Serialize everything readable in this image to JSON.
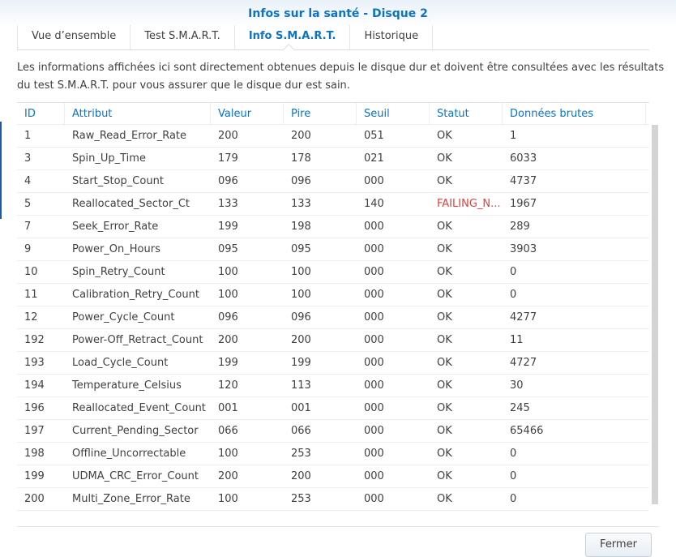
{
  "title": "Infos sur la santé - Disque 2",
  "tabs": [
    {
      "label": "Vue d’ensemble"
    },
    {
      "label": "Test S.M.A.R.T."
    },
    {
      "label": "Info S.M.A.R.T."
    },
    {
      "label": "Historique"
    }
  ],
  "active_tab": 2,
  "description": "Les informations affichées ici sont directement obtenues depuis le disque dur et doivent être consultées avec les résultats du test S.M.A.R.T. pour vous assurer que le disque dur est sain.",
  "columns": [
    "ID",
    "Attribut",
    "Valeur",
    "Pire",
    "Seuil",
    "Statut",
    "Données brutes"
  ],
  "rows": [
    [
      "1",
      "Raw_Read_Error_Rate",
      "200",
      "200",
      "051",
      "OK",
      "1"
    ],
    [
      "3",
      "Spin_Up_Time",
      "179",
      "178",
      "021",
      "OK",
      "6033"
    ],
    [
      "4",
      "Start_Stop_Count",
      "096",
      "096",
      "000",
      "OK",
      "4737"
    ],
    [
      "5",
      "Reallocated_Sector_Ct",
      "133",
      "133",
      "140",
      "FAILING_N...",
      "1967"
    ],
    [
      "7",
      "Seek_Error_Rate",
      "199",
      "198",
      "000",
      "OK",
      "289"
    ],
    [
      "9",
      "Power_On_Hours",
      "095",
      "095",
      "000",
      "OK",
      "3903"
    ],
    [
      "10",
      "Spin_Retry_Count",
      "100",
      "100",
      "000",
      "OK",
      "0"
    ],
    [
      "11",
      "Calibration_Retry_Count",
      "100",
      "100",
      "000",
      "OK",
      "0"
    ],
    [
      "12",
      "Power_Cycle_Count",
      "096",
      "096",
      "000",
      "OK",
      "4277"
    ],
    [
      "192",
      "Power-Off_Retract_Count",
      "200",
      "200",
      "000",
      "OK",
      "11"
    ],
    [
      "193",
      "Load_Cycle_Count",
      "199",
      "199",
      "000",
      "OK",
      "4727"
    ],
    [
      "194",
      "Temperature_Celsius",
      "120",
      "113",
      "000",
      "OK",
      "30"
    ],
    [
      "196",
      "Reallocated_Event_Count",
      "001",
      "001",
      "000",
      "OK",
      "245"
    ],
    [
      "197",
      "Current_Pending_Sector",
      "066",
      "066",
      "000",
      "OK",
      "65466"
    ],
    [
      "198",
      "Offline_Uncorrectable",
      "100",
      "253",
      "000",
      "OK",
      "0"
    ],
    [
      "199",
      "UDMA_CRC_Error_Count",
      "200",
      "200",
      "000",
      "OK",
      "0"
    ],
    [
      "200",
      "Multi_Zone_Error_Rate",
      "100",
      "253",
      "000",
      "OK",
      "0"
    ]
  ],
  "close_label": "Fermer",
  "colors": {
    "accent": "#0d73c4",
    "failing": "#e0413b"
  }
}
